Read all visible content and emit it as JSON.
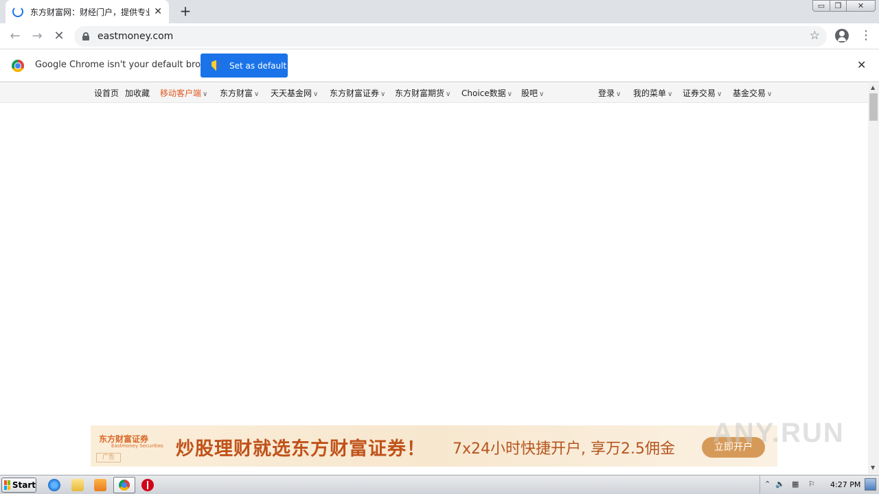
{
  "browser": {
    "tab_title": "东方财富网：财经门户，提供专业的",
    "tab_close": "✕",
    "new_tab": "+",
    "url": "eastmoney.com",
    "back": "←",
    "forward": "→",
    "stop": "✕",
    "star": "☆",
    "menu": "⋮"
  },
  "window_controls": {
    "minimize": "▭",
    "restore": "❐",
    "close": "✕"
  },
  "infobar": {
    "message": "Google Chrome isn't your default browser",
    "button": "Set as default",
    "close": "✕"
  },
  "site_nav": {
    "left": [
      {
        "label": "设首页",
        "dropdown": false,
        "highlight": false
      },
      {
        "label": "加收藏",
        "dropdown": false,
        "highlight": false
      },
      {
        "label": "移动客户端",
        "dropdown": true,
        "highlight": true
      },
      {
        "label": "东方财富",
        "dropdown": true,
        "highlight": false
      },
      {
        "label": "天天基金网",
        "dropdown": true,
        "highlight": false
      },
      {
        "label": "东方财富证券",
        "dropdown": true,
        "highlight": false
      },
      {
        "label": "东方财富期货",
        "dropdown": true,
        "highlight": false
      },
      {
        "label": "Choice数据",
        "dropdown": true,
        "highlight": false
      },
      {
        "label": "股吧",
        "dropdown": true,
        "highlight": false
      }
    ],
    "right": [
      {
        "label": "登录",
        "dropdown": true
      },
      {
        "label": "我的菜单",
        "dropdown": true
      },
      {
        "label": "证券交易",
        "dropdown": true
      },
      {
        "label": "基金交易",
        "dropdown": true
      }
    ],
    "caret": "∨"
  },
  "banner": {
    "logo": "东方财富证券",
    "logo_en": "Eastmoney Securities",
    "ad_tag": "广告",
    "headline": "炒股理财就选东方财富证券！",
    "subline": "7x24小时快捷开户, 享万2.5佣金",
    "button": "立即开户"
  },
  "watermark": "ANY.RUN",
  "taskbar": {
    "start": "Start",
    "clock": "4:27 PM",
    "tray": [
      "⌃",
      "🔈",
      "▦",
      "⚐"
    ]
  },
  "colors": {
    "accent": "#1a73e8",
    "nav_highlight": "#e2561d",
    "banner_text": "#c0521a"
  }
}
